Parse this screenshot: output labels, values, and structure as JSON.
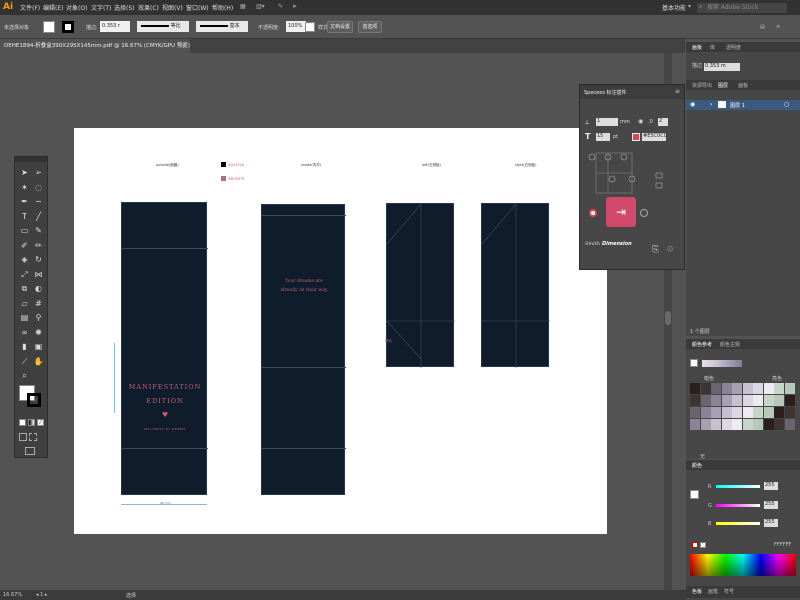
{
  "menubar": {
    "logo": "Ai",
    "items": [
      "文件(F)",
      "编辑(E)",
      "对象(O)",
      "文字(T)",
      "选择(S)",
      "效果(C)",
      "视图(V)",
      "窗口(W)",
      "帮助(H)"
    ],
    "workspace": "基本功能",
    "search_placeholder": "搜索 Adobe Stock"
  },
  "controlbar": {
    "selection": "未选择对象",
    "stroke_label": "描边:",
    "stroke_value": "0.353 r",
    "profile_label": "等比",
    "brush_label": "基本",
    "opacity_label": "不透明度:",
    "opacity_value": "100%",
    "style_label": "样式:",
    "doc_setup": "文档设置",
    "preferences": "首选项"
  },
  "document": {
    "tab_title": "DEHE1894-折叠盒390X295X145mm.pdf @ 16.67% (CMYK/GPU 预览)",
    "zoom": "16.67%",
    "status_tool": "选择"
  },
  "artboard": {
    "labels": [
      "outside(面膜)",
      "inside(内衬)",
      "left(左侧板)",
      "right(右侧板)"
    ],
    "swatch_labels": [
      "#0A1F2A",
      "#B76979"
    ],
    "panel1_title": "MANIFESTATION",
    "panel1_subtitle": "EDITION",
    "panel1_tagline": "WELLNESS BY DEBBIE",
    "panel2_line1": "Your dreams are",
    "panel2_line2": "already on their way",
    "dim_bottom": "98 mm",
    "callout": "提取"
  },
  "colors": {
    "dieline": "#0f1c2c",
    "accent_pink": "#c25f73",
    "panel_bg": "#474747",
    "swatch_pink": "#b76979",
    "swatch_black": "#000000"
  },
  "specees": {
    "title": "Specees 标注插件",
    "unit_value": "1",
    "unit": "mm",
    "count_value": "2",
    "font_size": "15",
    "font_unit": "pt",
    "hex": "#E5C0C0",
    "footer_brand": "Smith",
    "footer_word": "Dimension"
  },
  "layers_panel": {
    "tabs": [
      "画板",
      "库",
      "透明度"
    ],
    "stroke_weight": "0.353 m",
    "tabs2": [
      "资源导出",
      "图层",
      "画板"
    ],
    "layer_name": "图层 1",
    "layer_count": "1 个图层"
  },
  "swatch_panel": {
    "tabs": [
      "颜色参考",
      "颜色主题"
    ],
    "row_label": "暗色",
    "row_label2": "亮色",
    "footer": "无"
  },
  "color_panel": {
    "title": "颜色",
    "r_value": "255",
    "g_value": "255",
    "b_value": "255",
    "hex": "FFFFFF",
    "tabs": [
      "色板",
      "画笔",
      "符号"
    ]
  },
  "toolbar": {
    "icons": [
      "selection-icon",
      "direct-selection-icon",
      "magic-wand-icon",
      "lasso-icon",
      "pen-icon",
      "curvature-icon",
      "type-icon",
      "line-icon",
      "rectangle-icon",
      "brush-icon",
      "shaper-icon",
      "pencil-icon",
      "eraser-icon",
      "rotate-icon",
      "scale-icon",
      "width-icon",
      "free-transform-icon",
      "shape-builder-icon",
      "perspective-icon",
      "mesh-icon",
      "gradient-icon",
      "eyedropper-icon",
      "blend-icon",
      "symbol-sprayer-icon",
      "graph-icon",
      "artboard-icon",
      "slice-icon",
      "hand-icon",
      "zoom-icon"
    ]
  }
}
